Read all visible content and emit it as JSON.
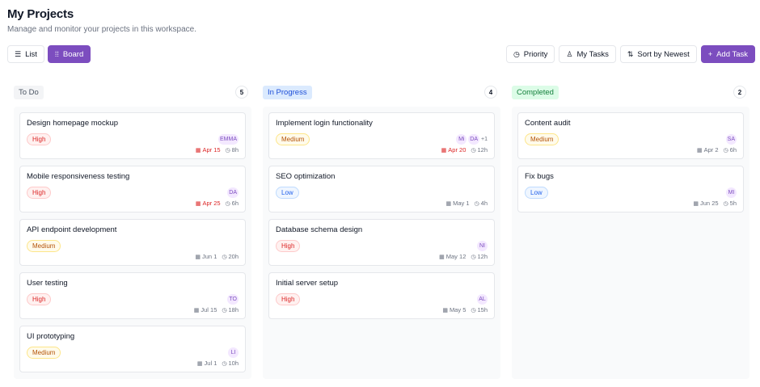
{
  "header": {
    "title": "My Projects",
    "subtitle": "Manage and monitor your projects in this workspace."
  },
  "toolbar": {
    "list_label": "List",
    "board_label": "Board",
    "priority_label": "Priority",
    "mytasks_label": "My Tasks",
    "sort_label": "Sort by Newest",
    "add_label": "Add Task"
  },
  "columns": {
    "todo": {
      "label": "To Do",
      "count": "5",
      "cards": [
        {
          "title": "Design homepage mockup",
          "priority": "High",
          "assignee": "EMMA",
          "date": "Apr 15",
          "hours": "8h"
        },
        {
          "title": "Mobile responsiveness testing",
          "priority": "High",
          "assignee": "DA",
          "date": "Apr 25",
          "hours": "6h"
        },
        {
          "title": "API endpoint development",
          "priority": "Medium",
          "assignee": "",
          "date": "Jun 1",
          "hours": "20h"
        },
        {
          "title": "User testing",
          "priority": "High",
          "assignee": "TO",
          "date": "Jul 15",
          "hours": "18h"
        },
        {
          "title": "UI prototyping",
          "priority": "Medium",
          "assignee": "LI",
          "date": "Jul 1",
          "hours": "10h"
        }
      ]
    },
    "progress": {
      "label": "In Progress",
      "count": "4",
      "cards": [
        {
          "title": "Implement login functionality",
          "priority": "Medium",
          "assignee": "Mi",
          "assignee2": "DA",
          "more": "+1",
          "date": "Apr 20",
          "hours": "12h"
        },
        {
          "title": "SEO optimization",
          "priority": "Low",
          "assignee": "",
          "date": "May 1",
          "hours": "4h"
        },
        {
          "title": "Database schema design",
          "priority": "High",
          "assignee": "NI",
          "date": "May 12",
          "hours": "12h"
        },
        {
          "title": "Initial server setup",
          "priority": "High",
          "assignee": "AL",
          "date": "May 5",
          "hours": "15h"
        }
      ]
    },
    "done": {
      "label": "Completed",
      "count": "2",
      "cards": [
        {
          "title": "Content audit",
          "priority": "Medium",
          "assignee": "SA",
          "date": "Apr 2",
          "hours": "6h"
        },
        {
          "title": "Fix bugs",
          "priority": "Low",
          "assignee": "MI",
          "date": "Jun 25",
          "hours": "5h"
        }
      ]
    }
  },
  "colors": {
    "accent": "#7c4dbf",
    "overdue": "#dc2626"
  },
  "icons": {
    "list": "list-icon",
    "board": "board-icon",
    "priority": "clock-icon",
    "mytasks": "user-icon",
    "sort": "sort-icon",
    "add": "plus-icon",
    "date": "calendar-icon",
    "hours": "clock-icon"
  }
}
